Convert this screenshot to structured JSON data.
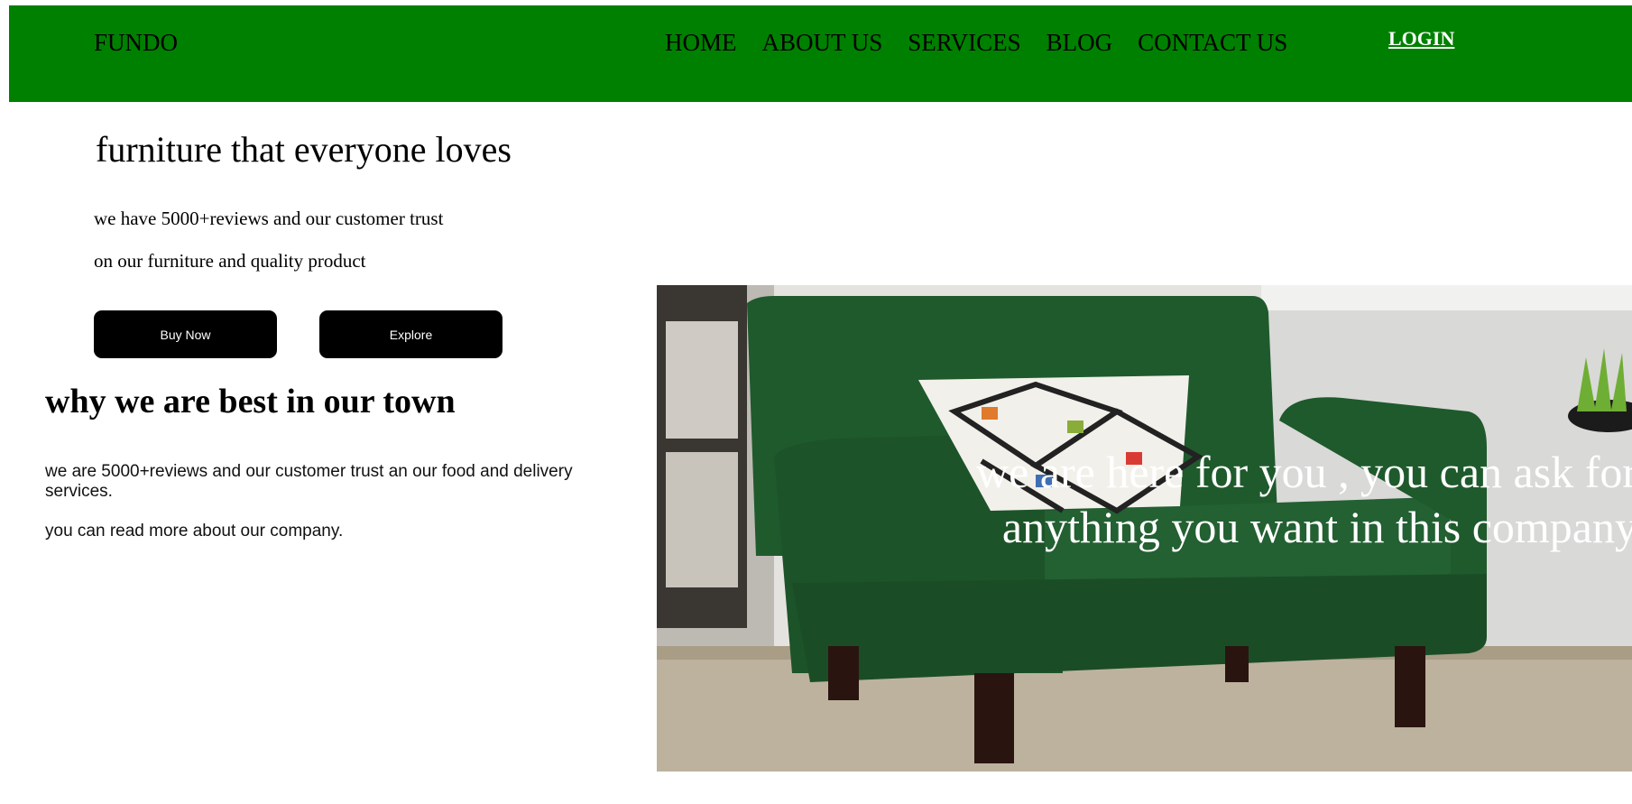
{
  "nav": {
    "logo": "FUNDO",
    "links": [
      "HOME",
      "ABOUT US",
      "SERVICES",
      "BLOG",
      "CONTACT US"
    ],
    "login": "LOGIN",
    "background": "#008000"
  },
  "hero": {
    "title": "furniture that everyone loves",
    "line1": "we have 5000+reviews and our customer trust",
    "line2": "on our furniture and quality product",
    "buy_label": "Buy Now",
    "explore_label": "Explore"
  },
  "why": {
    "title": "why we are best in our town",
    "p1": "we are 5000+reviews and our customer trust an our food and delivery services.",
    "p2": "you can read more about our company."
  },
  "image": {
    "overlay_line1": "we are here for you , you can ask for",
    "overlay_line2": "anything you want in this company"
  }
}
